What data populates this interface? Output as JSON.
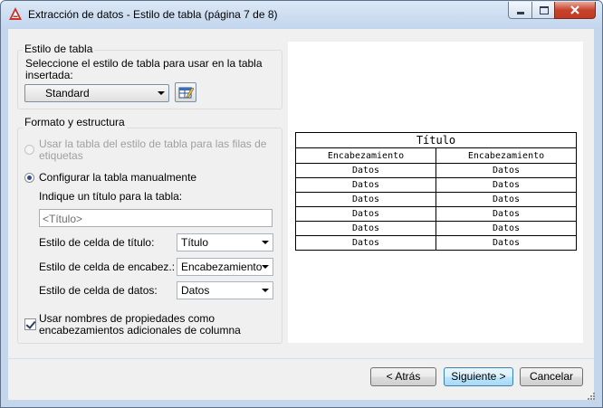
{
  "window": {
    "title": "Extracción de datos - Estilo de tabla (página 7 de 8)",
    "accent_color": "#c4d6ec"
  },
  "table_style": {
    "group_label": "Estilo de tabla",
    "description": "Seleccione el estilo de tabla para usar en la tabla insertada:",
    "selected": "Standard",
    "edit_icon": "table-style-edit-icon"
  },
  "format": {
    "group_label": "Formato y estructura",
    "option_use_style_rows": "Usar la tabla del estilo de tabla para las filas de etiquetas",
    "option_manual": "Configurar la tabla manualmente",
    "title_prompt": "Indique un título para la tabla:",
    "title_placeholder": "<Título>",
    "title_cell_label": "Estilo de celda de título:",
    "title_cell_value": "Título",
    "header_cell_label": "Estilo de celda de encabez.:",
    "header_cell_value": "Encabezamiento",
    "data_cell_label": "Estilo de celda de datos:",
    "data_cell_value": "Datos",
    "use_property_names": "Usar nombres de propiedades como encabezamientos adicionales de columna",
    "use_property_names_checked": true,
    "use_style_rows_enabled": false,
    "manual_selected": true
  },
  "preview": {
    "title": "Título",
    "headers": [
      "Encabezamiento",
      "Encabezamiento"
    ],
    "rows": [
      [
        "Datos",
        "Datos"
      ],
      [
        "Datos",
        "Datos"
      ],
      [
        "Datos",
        "Datos"
      ],
      [
        "Datos",
        "Datos"
      ],
      [
        "Datos",
        "Datos"
      ],
      [
        "Datos",
        "Datos"
      ]
    ]
  },
  "buttons": {
    "back": "< Atrás",
    "next": "Siguiente >",
    "cancel": "Cancelar"
  }
}
